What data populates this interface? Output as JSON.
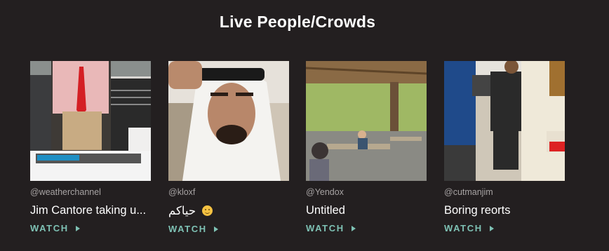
{
  "section": {
    "title": "Live People/Crowds"
  },
  "cards": [
    {
      "user": "@weatherchannel",
      "title": "Jim Cantore taking u...",
      "watch": "WATCH",
      "thumbnail_icon": "video-thumbnail-icon"
    },
    {
      "user": "@kloxf",
      "title": "حياكم",
      "emoji": "smiling-face-icon",
      "watch": "WATCH",
      "thumbnail_icon": "video-thumbnail-icon"
    },
    {
      "user": "@Yendox",
      "title": "Untitled",
      "watch": "WATCH",
      "thumbnail_icon": "video-thumbnail-icon"
    },
    {
      "user": "@cutmanjim",
      "title": "Boring reorts",
      "watch": "WATCH",
      "thumbnail_icon": "video-thumbnail-icon"
    }
  ],
  "colors": {
    "background": "#231f20",
    "accent": "#7ec1b4",
    "username": "#a7a3a3",
    "text": "#ffffff"
  }
}
